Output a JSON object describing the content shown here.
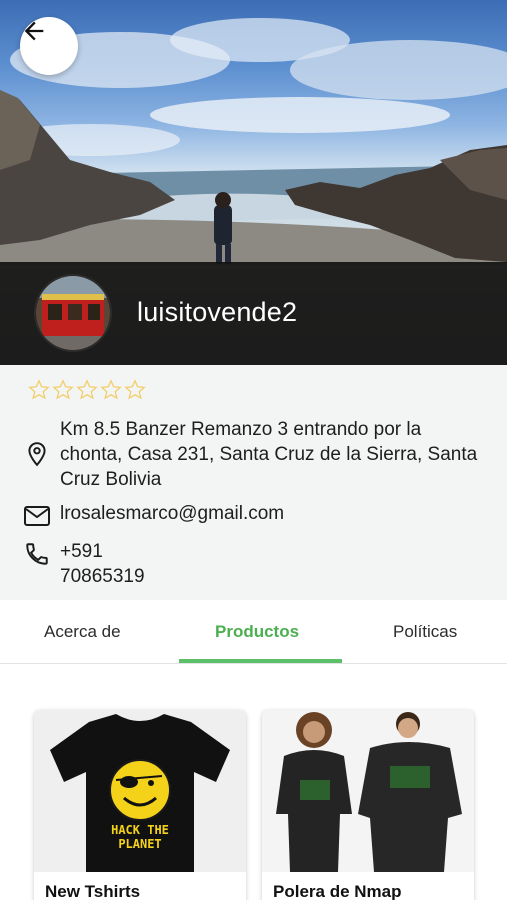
{
  "header": {
    "back_icon": "arrow-left-icon",
    "username": "luisitovende2"
  },
  "profile": {
    "rating": 0,
    "rating_max": 5,
    "star_color": "#f2cf6a",
    "address": "Km 8.5 Banzer Remanzo 3 entrando por la chonta, Casa 231, Santa Cruz de la Sierra, Santa Cruz Bolivia",
    "email": "lrosalesmarco@gmail.com",
    "phone": "+591 70865319"
  },
  "tabs": [
    {
      "label": "Acerca de",
      "active": false
    },
    {
      "label": "Productos",
      "active": true
    },
    {
      "label": "Políticas",
      "active": false
    }
  ],
  "accent_color": "#4caf50",
  "products": [
    {
      "title": "New Tshirts",
      "shirt_text": "HACK THE PLANET"
    },
    {
      "title": "Polera de Nmap"
    }
  ]
}
